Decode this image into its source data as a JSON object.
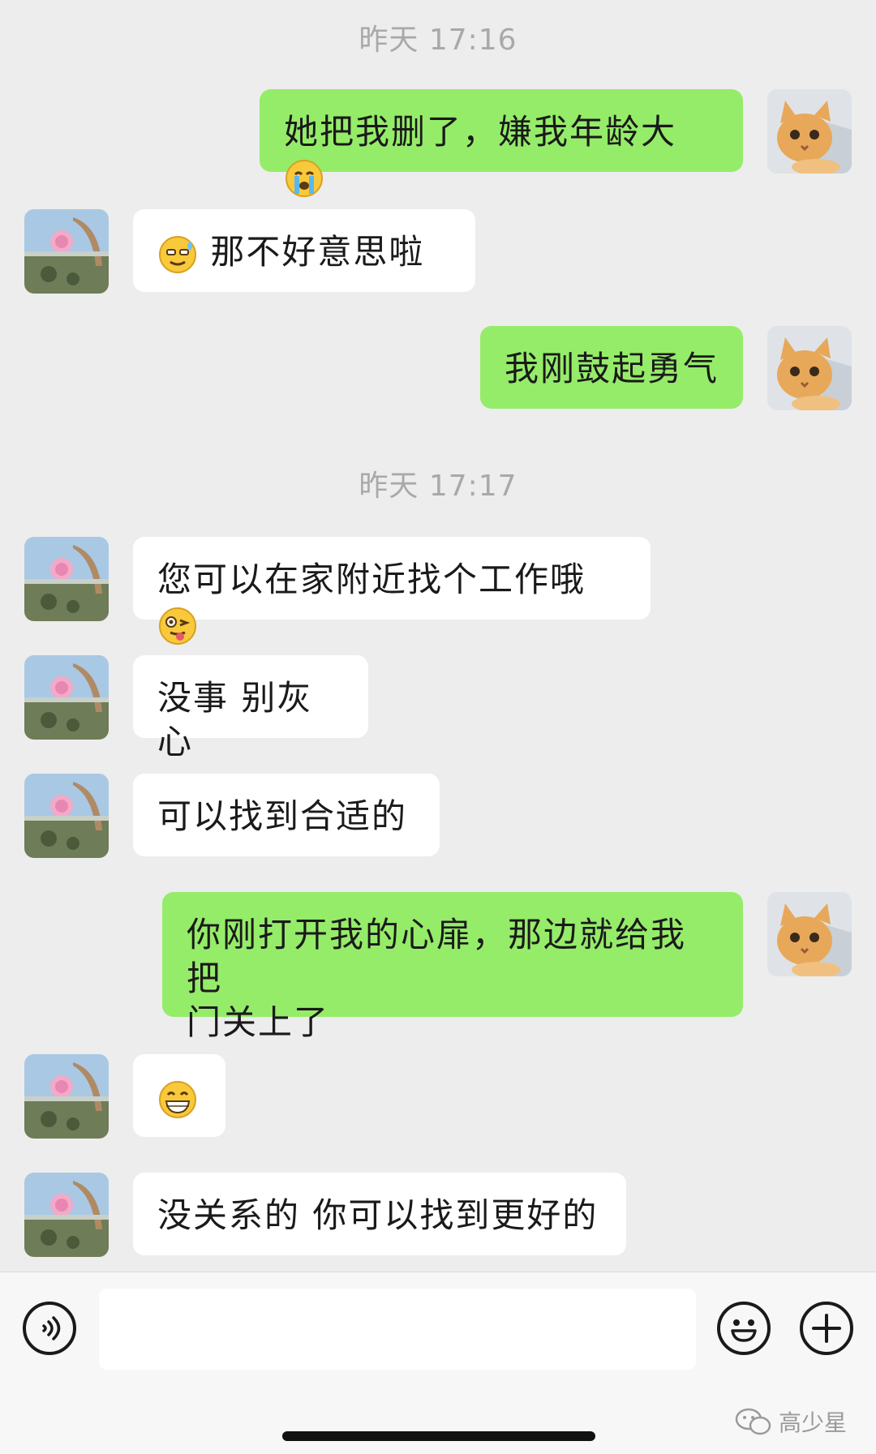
{
  "timestamps": [
    "昨天 17:16",
    "昨天 17:17"
  ],
  "messages": [
    {
      "side": "out",
      "text": "她把我删了，嫌我年龄大",
      "emoji": "crying-face"
    },
    {
      "side": "in",
      "text": "那不好意思啦",
      "emoji_leading": "sweat-smile-face"
    },
    {
      "side": "out",
      "text": "我刚鼓起勇气"
    },
    {
      "side": "in",
      "text": "您可以在家附近找个工作哦",
      "emoji": "wink-tongue-face"
    },
    {
      "side": "in",
      "text": "没事 别灰心"
    },
    {
      "side": "in",
      "text": "可以找到合适的"
    },
    {
      "side": "out",
      "text_line1": "你刚打开我的心扉，那边就给我把",
      "text_line2": "门关上了"
    },
    {
      "side": "in",
      "emoji_only": "grinning-face"
    },
    {
      "side": "in",
      "text": "没关系的 你可以找到更好的"
    }
  ],
  "composer": {
    "voice_icon": "voice-icon",
    "emoji_icon": "emoji-icon",
    "plus_icon": "plus-icon"
  },
  "watermark": {
    "text": "高少星"
  },
  "colors": {
    "outgoing": "#95ec69",
    "incoming": "#ffffff",
    "background": "#ededed"
  }
}
